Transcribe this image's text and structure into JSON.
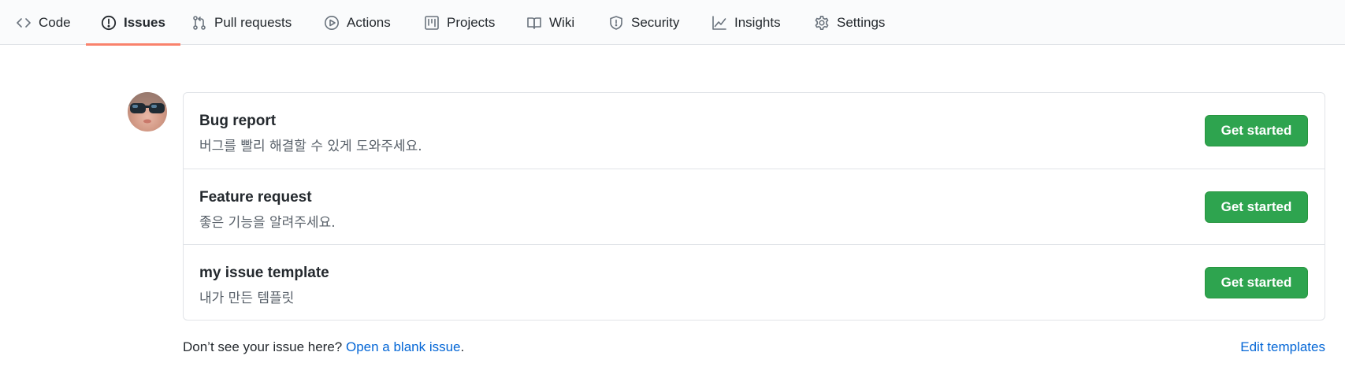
{
  "nav": {
    "tabs": [
      {
        "label": "Code",
        "icon": "code-icon"
      },
      {
        "label": "Issues",
        "icon": "issue-opened-icon",
        "selected": true
      },
      {
        "label": "Pull requests",
        "icon": "git-pull-request-icon"
      },
      {
        "label": "Actions",
        "icon": "play-icon"
      },
      {
        "label": "Projects",
        "icon": "project-icon"
      },
      {
        "label": "Wiki",
        "icon": "book-icon"
      },
      {
        "label": "Security",
        "icon": "shield-icon"
      },
      {
        "label": "Insights",
        "icon": "graph-icon"
      },
      {
        "label": "Settings",
        "icon": "gear-icon"
      }
    ],
    "selected_color": "#f9826c"
  },
  "templates": [
    {
      "title": "Bug report",
      "description": "버그를 빨리 해결할 수 있게 도와주세요.",
      "button": "Get started"
    },
    {
      "title": "Feature request",
      "description": "좋은 기능을 알려주세요.",
      "button": "Get started"
    },
    {
      "title": "my issue template",
      "description": "내가 만든 템플릿",
      "button": "Get started"
    }
  ],
  "footer": {
    "prompt": "Don’t see your issue here?",
    "blank_issue_link": "Open a blank issue",
    "period": ".",
    "edit_templates": "Edit templates"
  },
  "colors": {
    "primary_button": "#2ea44f",
    "link": "#0366d6",
    "muted_text": "#586069",
    "border": "#e1e4e8"
  }
}
